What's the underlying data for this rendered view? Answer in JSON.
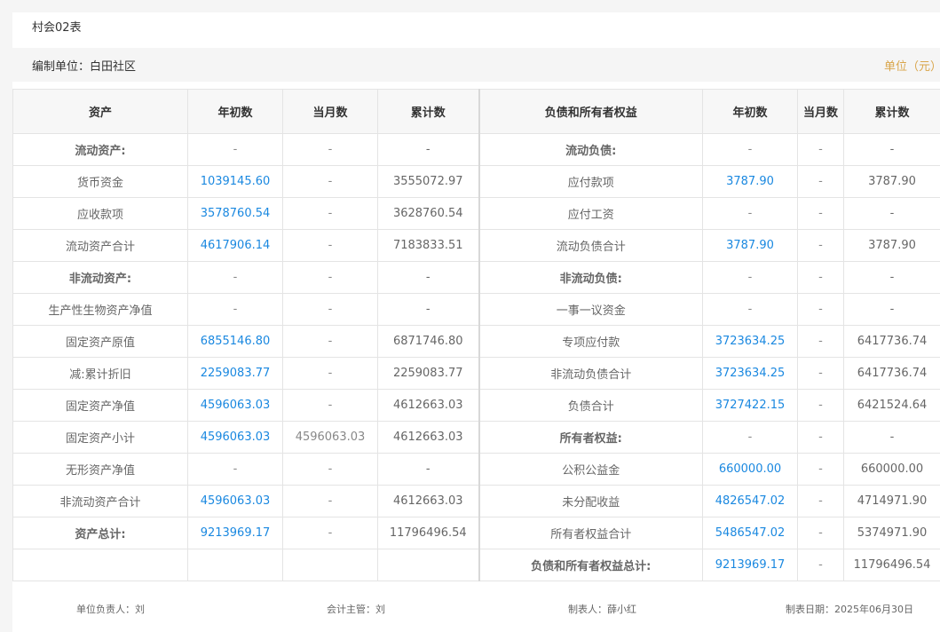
{
  "form_title": "村会02表",
  "org": {
    "label": "编制单位：白田社区"
  },
  "unit": {
    "label": "单位（元）"
  },
  "colors": {
    "link_blue": "#1a88e0",
    "unit_gold": "#d9a54a"
  },
  "headers": [
    "资产",
    "年初数",
    "当月数",
    "累计数",
    "负债和所有者权益",
    "年初数",
    "当月数",
    "累计数"
  ],
  "rows": [
    {
      "left_name": "流动资产:",
      "left_section": true,
      "left_beg": "-",
      "left_month": "-",
      "left_cum": "-",
      "right_name": "流动负债:",
      "right_section": true,
      "right_beg": "-",
      "right_month": "-",
      "right_cum": "-"
    },
    {
      "left_name": "货币资金",
      "left_section": false,
      "left_beg": "1039145.60",
      "left_month": "-",
      "left_cum": "3555072.97",
      "right_name": "应付款项",
      "right_section": false,
      "right_beg": "3787.90",
      "right_month": "-",
      "right_cum": "3787.90"
    },
    {
      "left_name": "应收款项",
      "left_section": false,
      "left_beg": "3578760.54",
      "left_month": "-",
      "left_cum": "3628760.54",
      "right_name": "应付工资",
      "right_section": false,
      "right_beg": "-",
      "right_month": "-",
      "right_cum": "-"
    },
    {
      "left_name": "流动资产合计",
      "left_section": false,
      "left_beg": "4617906.14",
      "left_month": "-",
      "left_cum": "7183833.51",
      "right_name": "流动负债合计",
      "right_section": false,
      "right_beg": "3787.90",
      "right_month": "-",
      "right_cum": "3787.90"
    },
    {
      "left_name": "非流动资产:",
      "left_section": true,
      "left_beg": "-",
      "left_month": "-",
      "left_cum": "-",
      "right_name": "非流动负债:",
      "right_section": true,
      "right_beg": "-",
      "right_month": "-",
      "right_cum": "-"
    },
    {
      "left_name": "生产性生物资产净值",
      "left_section": false,
      "left_beg": "-",
      "left_month": "-",
      "left_cum": "-",
      "right_name": "一事一议资金",
      "right_section": false,
      "right_beg": "-",
      "right_month": "-",
      "right_cum": "-"
    },
    {
      "left_name": "固定资产原值",
      "left_section": false,
      "left_beg": "6855146.80",
      "left_month": "-",
      "left_cum": "6871746.80",
      "right_name": "专项应付款",
      "right_section": false,
      "right_beg": "3723634.25",
      "right_month": "-",
      "right_cum": "6417736.74"
    },
    {
      "left_name": "减:累计折旧",
      "left_section": false,
      "left_beg": "2259083.77",
      "left_month": "-",
      "left_cum": "2259083.77",
      "right_name": "非流动负债合计",
      "right_section": false,
      "right_beg": "3723634.25",
      "right_month": "-",
      "right_cum": "6417736.74"
    },
    {
      "left_name": "固定资产净值",
      "left_section": false,
      "left_beg": "4596063.03",
      "left_month": "-",
      "left_cum": "4612663.03",
      "right_name": "负债合计",
      "right_section": false,
      "right_beg": "3727422.15",
      "right_month": "-",
      "right_cum": "6421524.64"
    },
    {
      "left_name": "固定资产小计",
      "left_section": false,
      "left_beg": "4596063.03",
      "left_month": "4596063.03",
      "left_cum": "4612663.03",
      "right_name": "所有者权益:",
      "right_section": true,
      "right_beg": "-",
      "right_month": "-",
      "right_cum": "-"
    },
    {
      "left_name": "无形资产净值",
      "left_section": false,
      "left_beg": "-",
      "left_month": "-",
      "left_cum": "-",
      "right_name": "公积公益金",
      "right_section": false,
      "right_beg": "660000.00",
      "right_month": "-",
      "right_cum": "660000.00"
    },
    {
      "left_name": "非流动资产合计",
      "left_section": false,
      "left_beg": "4596063.03",
      "left_month": "-",
      "left_cum": "4612663.03",
      "right_name": "未分配收益",
      "right_section": false,
      "right_beg": "4826547.02",
      "right_month": "-",
      "right_cum": "4714971.90"
    },
    {
      "left_name": "资产总计:",
      "left_section": true,
      "left_beg": "9213969.17",
      "left_month": "-",
      "left_cum": "11796496.54",
      "right_name": "所有者权益合计",
      "right_section": false,
      "right_beg": "5486547.02",
      "right_month": "-",
      "right_cum": "5374971.90"
    },
    {
      "left_name": "",
      "left_section": false,
      "left_beg": "",
      "left_month": "",
      "left_cum": "",
      "right_name": "负债和所有者权益总计:",
      "right_section": true,
      "right_beg": "9213969.17",
      "right_month": "-",
      "right_cum": "11796496.54"
    }
  ],
  "footer": [
    {
      "text": "单位负责人：刘"
    },
    {
      "text": "会计主管：刘"
    },
    {
      "text": "制表人：薛小红"
    },
    {
      "text": "制表日期：2025年06月30日"
    }
  ]
}
